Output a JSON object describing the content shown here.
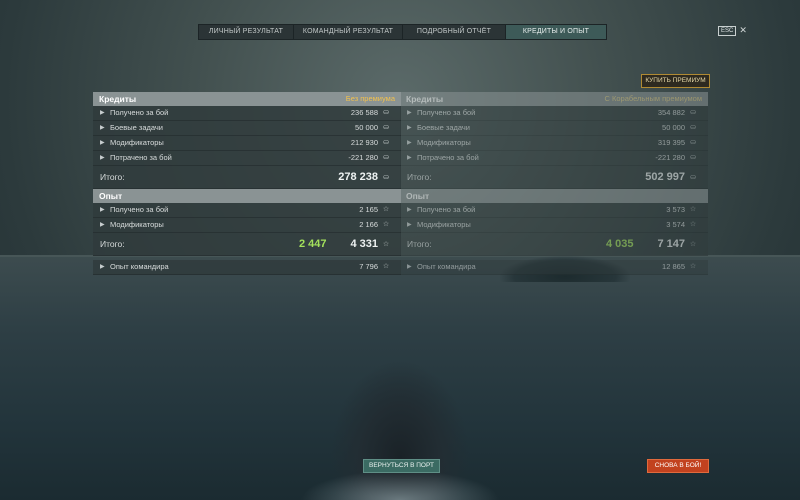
{
  "tabs": [
    {
      "label": "ЛИЧНЫЙ РЕЗУЛЬТАТ"
    },
    {
      "label": "КОМАНДНЫЙ РЕЗУЛЬТАТ"
    },
    {
      "label": "ПОДРОБНЫЙ ОТЧЁТ"
    },
    {
      "label": "КРЕДИТЫ И ОПЫТ"
    }
  ],
  "esc": {
    "key": "ESC",
    "close": "✕"
  },
  "buy_premium": "КУПИТЬ ПРЕМИУМ",
  "left": {
    "credits_title": "Кредиты",
    "credits_tag": "Без премиума",
    "credit_rows": [
      {
        "label": "Получено за бой",
        "value": "236 588"
      },
      {
        "label": "Боевые задачи",
        "value": "50 000"
      },
      {
        "label": "Модификаторы",
        "value": "212 930"
      },
      {
        "label": "Потрачено за бой",
        "value": "-221 280"
      }
    ],
    "credits_total_label": "Итого:",
    "credits_total": "278 238",
    "xp_title": "Опыт",
    "xp_rows": [
      {
        "label": "Получено за бой",
        "value": "2 165"
      },
      {
        "label": "Модификаторы",
        "value": "2 166"
      }
    ],
    "xp_total_label": "Итого:",
    "xp_free": "2 447",
    "xp_total": "4 331",
    "commander_label": "Опыт командира",
    "commander_value": "7 796"
  },
  "right": {
    "credits_title": "Кредиты",
    "credits_tag": "С Корабельным премиумом",
    "credit_rows": [
      {
        "label": "Получено за бой",
        "value": "354 882"
      },
      {
        "label": "Боевые задачи",
        "value": "50 000"
      },
      {
        "label": "Модификаторы",
        "value": "319 395"
      },
      {
        "label": "Потрачено за бой",
        "value": "-221 280"
      }
    ],
    "credits_total_label": "Итого:",
    "credits_total": "502 997",
    "xp_title": "Опыт",
    "xp_rows": [
      {
        "label": "Получено за бой",
        "value": "3 573"
      },
      {
        "label": "Модификаторы",
        "value": "3 574"
      }
    ],
    "xp_total_label": "Итого:",
    "xp_free": "4 035",
    "xp_total": "7 147",
    "commander_label": "Опыт командира",
    "commander_value": "12 865"
  },
  "buttons": {
    "port": "ВЕРНУТЬСЯ В ПОРТ",
    "battle": "СНОВА В БОЙ!"
  },
  "colors": {
    "accent_gold": "#f2c14e",
    "free_xp_green": "#a3e05c",
    "battle_red": "#c2421f",
    "port_teal": "#3b6b63"
  },
  "icons": {
    "credit": "coin-icon",
    "xp": "star-icon",
    "row": "arrow-right-icon"
  }
}
